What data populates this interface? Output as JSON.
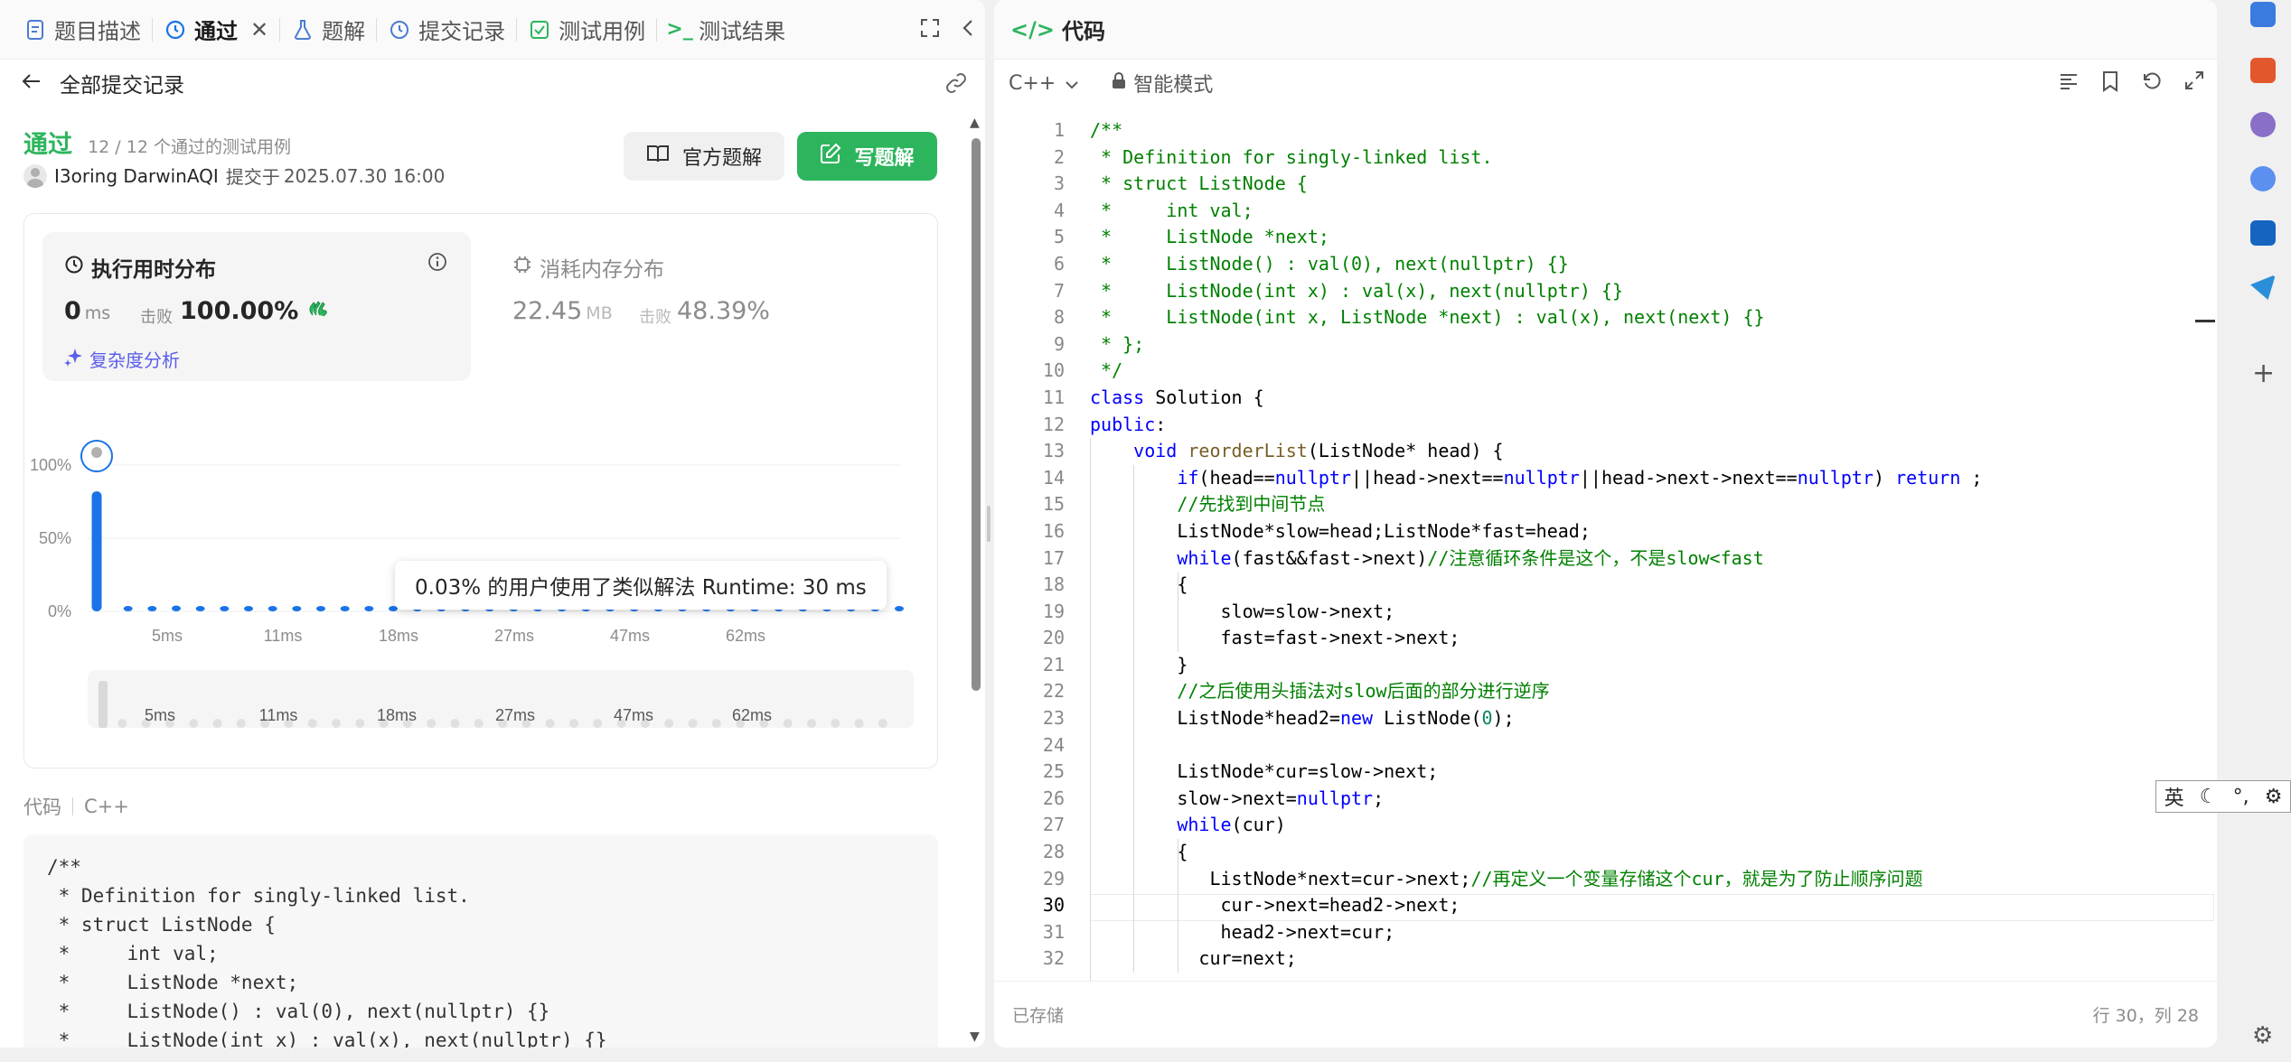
{
  "left_tabs": [
    {
      "label": "题目描述",
      "icon": "description-icon"
    },
    {
      "label": "通过",
      "icon": "history-icon"
    },
    {
      "label": "题解",
      "icon": "flask-icon"
    },
    {
      "label": "提交记录",
      "icon": "history-icon"
    },
    {
      "label": "测试用例",
      "icon": "checkbox-icon"
    },
    {
      "label": "测试结果",
      "icon": "terminal-icon"
    }
  ],
  "back": {
    "label": "全部提交记录"
  },
  "result": {
    "status": "通过",
    "cases": "12 / 12 个通过的测试用例",
    "author": "I3oring DarwinAQI",
    "submit_label": "提交于",
    "submit_time": "2025.07.30 16:00",
    "official_button": "官方题解",
    "write_button": "写题解"
  },
  "runtime": {
    "title": "执行用时分布",
    "value": "0",
    "unit": "ms",
    "beat_label": "击败",
    "beat_value": "100.00%",
    "complexity_label": "复杂度分析"
  },
  "memory": {
    "title": "消耗内存分布",
    "value": "22.45",
    "unit": "MB",
    "beat_label": "击败",
    "beat_value": "48.39%"
  },
  "chart_data": {
    "type": "bar",
    "y_ticks": [
      "100%",
      "50%",
      "0%"
    ],
    "ylim": [
      0,
      100
    ],
    "x_ticks": [
      "5ms",
      "11ms",
      "18ms",
      "27ms",
      "47ms",
      "62ms"
    ],
    "values": [
      82,
      2,
      2,
      4,
      2,
      2,
      2,
      2,
      2,
      2,
      2,
      2,
      2,
      2,
      2,
      2,
      2,
      2,
      2,
      2,
      2,
      2,
      2,
      2,
      2,
      2,
      2,
      2,
      2,
      2,
      2,
      2,
      2,
      2
    ],
    "highlight_index": 0,
    "tooltip": "0.03% 的用户使用了类似解法 Runtime: 30 ms",
    "mini_x_ticks": [
      "5ms",
      "11ms",
      "18ms",
      "27ms",
      "47ms",
      "62ms"
    ]
  },
  "code_section": {
    "label": "代码",
    "language": "C++",
    "preview_lines": [
      "/**",
      " * Definition for singly-linked list.",
      " * struct ListNode {",
      " *     int val;",
      " *     ListNode *next;",
      " *     ListNode() : val(0), next(nullptr) {}",
      " *     ListNode(int x) : val(x), next(nullptr) {}"
    ]
  },
  "editor": {
    "title": "代码",
    "language": "C++",
    "mode": "智能模式",
    "saved": "已存储",
    "cursor": "行 30，列 28",
    "current_line": 30,
    "lines": [
      "/**",
      " * Definition for singly-linked list.",
      " * struct ListNode {",
      " *     int val;",
      " *     ListNode *next;",
      " *     ListNode() : val(0), next(nullptr) {}",
      " *     ListNode(int x) : val(x), next(nullptr) {}",
      " *     ListNode(int x, ListNode *next) : val(x), next(next) {}",
      " * };",
      " */",
      "class Solution {",
      "public:",
      "    void reorderList(ListNode* head) {",
      "        if(head==nullptr||head->next==nullptr||head->next->next==nullptr) return ;",
      "        //先找到中间节点",
      "        ListNode*slow=head;ListNode*fast=head;",
      "        while(fast&&fast->next)//注意循环条件是这个，不是slow<fast",
      "        {",
      "            slow=slow->next;",
      "            fast=fast->next->next;",
      "        }",
      "        //之后使用头插法对slow后面的部分进行逆序",
      "        ListNode*head2=new ListNode(0);",
      "",
      "        ListNode*cur=slow->next;",
      "        slow->next=nullptr;",
      "        while(cur)",
      "        {",
      "           ListNode*next=cur->next;//再定义一个变量存储这个cur，就是为了防止顺序问题",
      "            cur->next=head2->next;",
      "            head2->next=cur;",
      "          cur=next;"
    ]
  },
  "ime": {
    "label": "英"
  },
  "colors": {
    "accent": "#2db55d",
    "bar": "#1a73e8",
    "bar_muted": "#e0e0e0",
    "link": "#5a5de8"
  }
}
